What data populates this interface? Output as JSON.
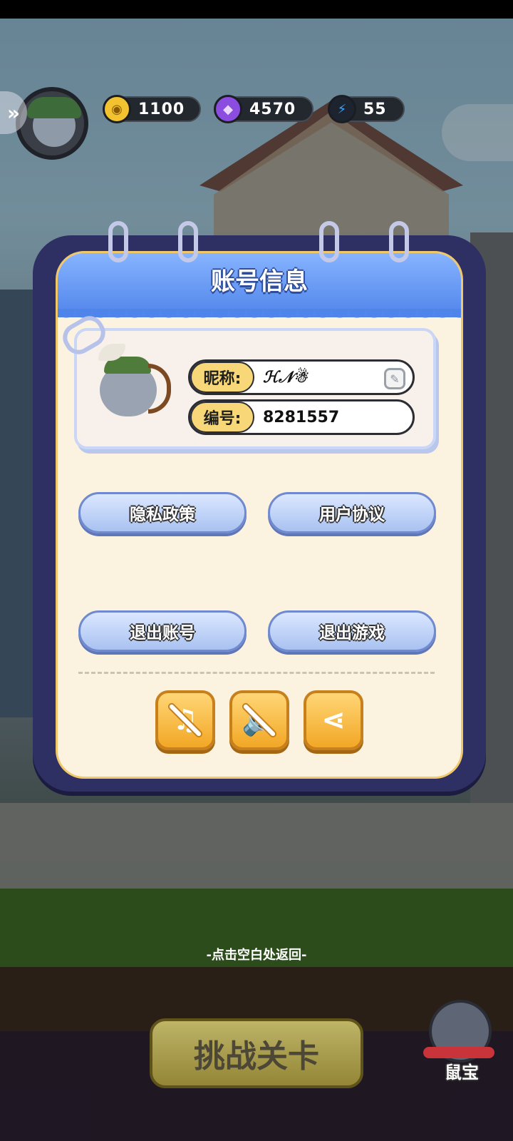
{
  "hud": {
    "gold": "1100",
    "gems": "4570",
    "energy": "55"
  },
  "modal": {
    "title": "账号信息",
    "nickname_label": "昵称:",
    "nickname_value": "ℋ𝒩☃",
    "id_label": "编号:",
    "id_value": "8281557",
    "buttons": {
      "privacy": "隐私政策",
      "agreement": "用户协议",
      "logout": "退出账号",
      "quit": "退出游戏"
    },
    "icons": [
      "music-off-icon",
      "sound-off-icon",
      "share-icon"
    ]
  },
  "hint": "-点击空白处返回-",
  "challenge_button": "挑战关卡",
  "pet_button": "鼠宝",
  "colors": {
    "modal_frame": "#2e2f63",
    "modal_header": "#4f84ea",
    "gold_button": "#f2a725",
    "label_pill": "#f7d777"
  }
}
